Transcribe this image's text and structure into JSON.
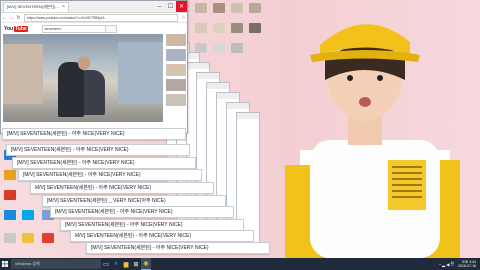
{
  "browser": {
    "tab_title": "[M/V] SEVENTEEN(세븐틴)...",
    "url": "https://www.youtube.com/watch?v=KzHE7RB5pIA",
    "logo_text": "You",
    "logo_tube": "Tube",
    "search_value": "seventeen",
    "minimize": "–",
    "maximize": "☐",
    "close": "✕",
    "video_title": "[M/V] SEVENTEEN(세븐틴) - 아주 NICE(VERY NICE)"
  },
  "stack_titles": [
    "[M/V] SEVENTEEN(세븐틴) - 아주 NICE(VERY NICE)",
    "[M/V] SEVENTEEN(세븐틴) - 아주 NICE(VERY NICE)",
    "[M/V] SEVENTEEN(세븐틴) - 아주 NICE(VERY NICE)",
    "[M/V] SEVENTEEN(세븐틴) - 아주 NICE(VERY NICE)",
    "M/V] SEVENTEEN(세븐틴) - 아주 NICE(VERY NICE)",
    "[M/V] SEVENTEEN(세븐틴) _ VERY NICE(아주 NICE)",
    "M/V] SEVENTEEN(세븐틴) - 아주 NICE(VERY NICE)",
    "[M/V] SEVENTEEN(세븐틴) - 아주 NICE(VERY NICE)",
    "[M/V] SEVENTEEN(세븐틴) - 아주 NICE(VERY NICE)",
    "[M/V] SEVENTEEN(세븐틴) - 아주 NICE(VERY NICE)"
  ],
  "taskbar": {
    "search_placeholder": "Windows 검색",
    "tray_lang": "한",
    "time": "오후 3:44",
    "date": "2016-07-16"
  },
  "colors": {
    "taskbar": "#1f2a3a",
    "wallpaper": "#f4d2d6",
    "youtube_red": "#e62117",
    "cap_yellow": "#f2c21a"
  }
}
